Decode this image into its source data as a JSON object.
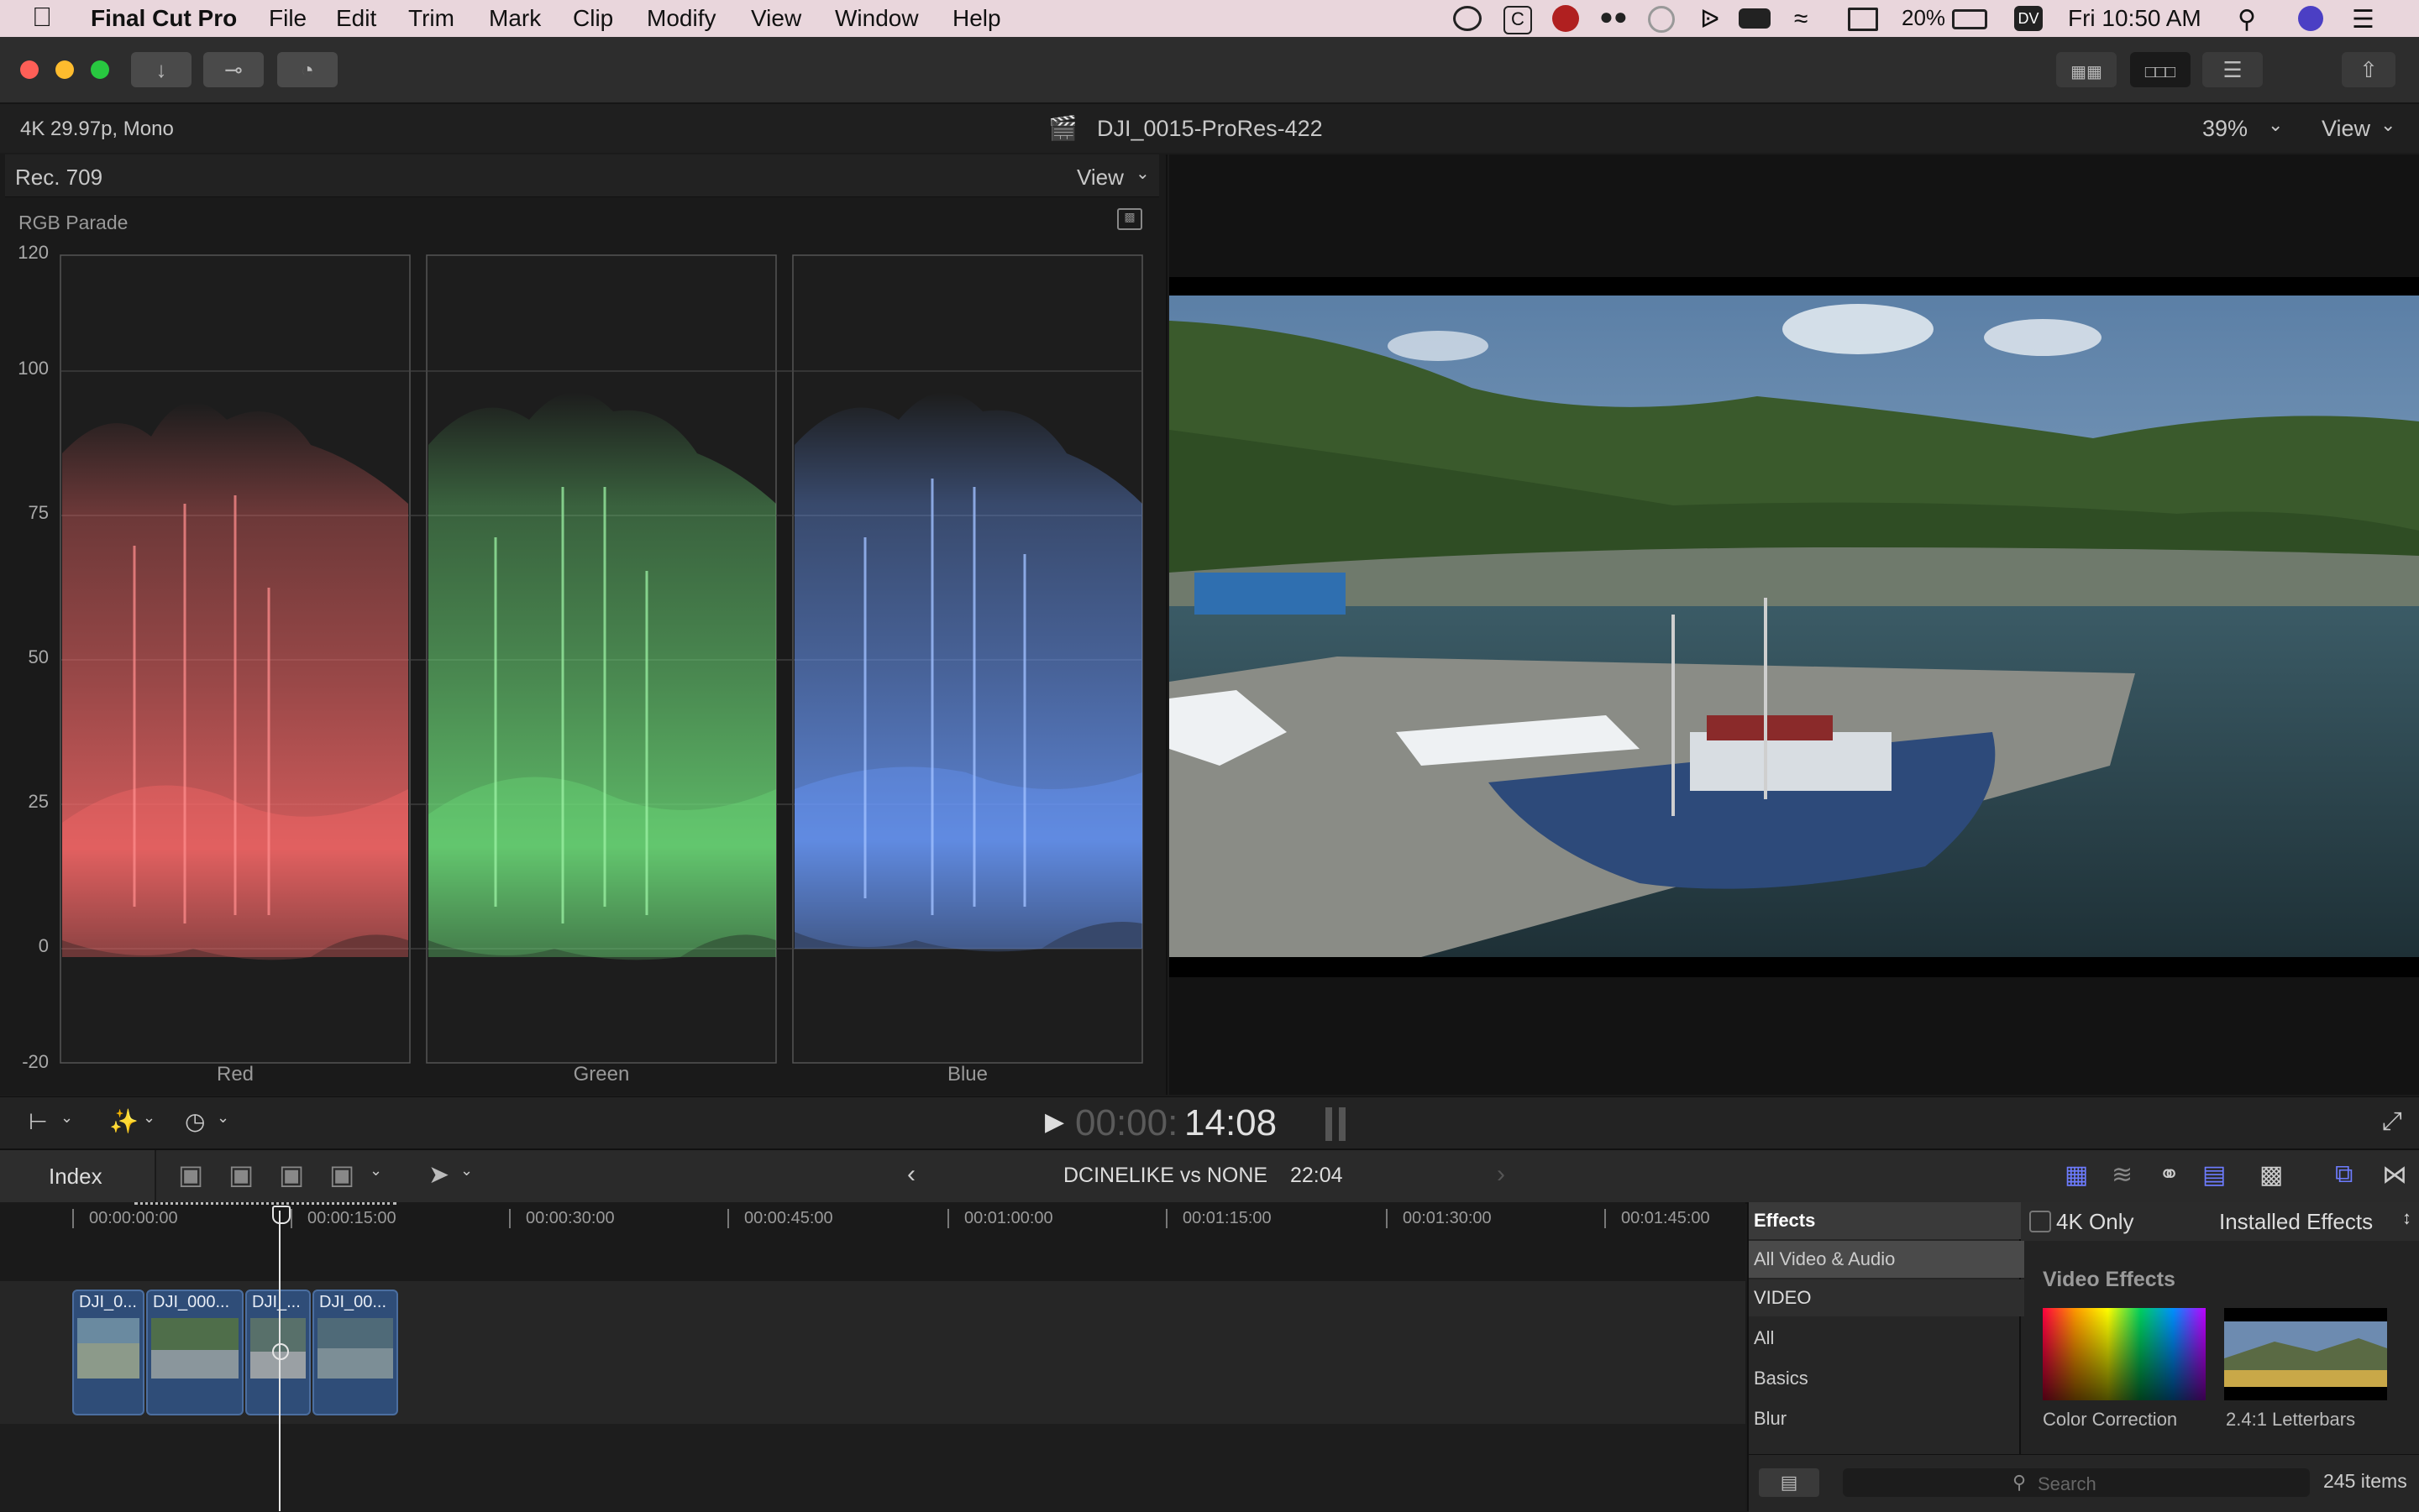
{
  "menubar": {
    "app_name": "Final Cut Pro",
    "items": [
      "File",
      "Edit",
      "Trim",
      "Mark",
      "Clip",
      "Modify",
      "View",
      "Window",
      "Help"
    ],
    "battery": "20%",
    "dv_badge": "DV",
    "clock": "Fri 10:50 AM"
  },
  "info": {
    "format": "4K 29.97p, Mono",
    "clip_name": "DJI_0015-ProRes-422",
    "zoom": "39%",
    "view_label": "View"
  },
  "scope": {
    "colorspace": "Rec. 709",
    "view_label": "View",
    "title": "RGB Parade",
    "y_ticks": [
      "120",
      "100",
      "75",
      "50",
      "25",
      "0",
      "-20"
    ],
    "channels": [
      "Red",
      "Green",
      "Blue"
    ]
  },
  "controls": {
    "timecode_dim": "00:00:",
    "timecode_bright": "14:08"
  },
  "timeline": {
    "index_label": "Index",
    "project_name": "DCINELIKE vs NONE",
    "duration": "22:04",
    "ruler": [
      "00:00:00:00",
      "00:00:15:00",
      "00:00:30:00",
      "00:00:45:00",
      "00:01:00:00",
      "00:01:15:00",
      "00:01:30:00",
      "00:01:45:00"
    ],
    "clips": [
      {
        "label": "DJI_0..."
      },
      {
        "label": "DJI_000..."
      },
      {
        "label": "DJI_..."
      },
      {
        "label": "DJI_00..."
      }
    ]
  },
  "effects": {
    "header": "Effects",
    "filter_4k": "4K Only",
    "installed": "Installed Effects",
    "categories": [
      "All Video & Audio",
      "VIDEO",
      "All",
      "Basics",
      "Blur"
    ],
    "section_title": "Video Effects",
    "items": [
      {
        "name": "Color Correction"
      },
      {
        "name": "2.4:1 Letterbars"
      }
    ],
    "search_placeholder": "Search",
    "count": "245 items"
  },
  "colors": {
    "accent": "#6d7cff",
    "red_trace": "#ff6b6b",
    "green_trace": "#6ee07a",
    "blue_trace": "#6b9cff"
  }
}
